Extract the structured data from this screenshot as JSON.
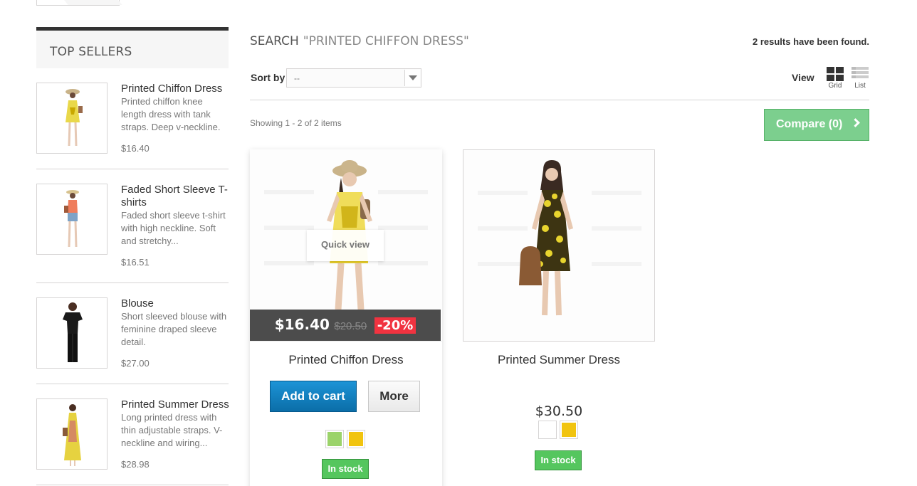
{
  "sidebar": {
    "title": "TOP SELLERS",
    "items": [
      {
        "name": "Printed Chiffon Dress",
        "desc": "Printed chiffon knee length dress with tank straps. Deep v-neckline.",
        "price": "$16.40"
      },
      {
        "name": "Faded Short Sleeve T-shirts",
        "desc": "Faded short sleeve t-shirt with high neckline. Soft and stretchy...",
        "price": "$16.51"
      },
      {
        "name": "Blouse",
        "desc": "Short sleeved blouse with feminine draped sleeve detail.",
        "price": "$27.00"
      },
      {
        "name": "Printed Summer Dress",
        "desc": "Long printed dress with thin adjustable straps. V-neckline and wiring...",
        "price": "$28.98"
      }
    ]
  },
  "search": {
    "label": "SEARCH",
    "query": "\"PRINTED CHIFFON DRESS\"",
    "results": "2 results have been found."
  },
  "toolbar": {
    "sort_label": "Sort by",
    "sort_value": "--",
    "view_label": "View",
    "grid_label": "Grid",
    "list_label": "List",
    "showing": "Showing 1 - 2 of 2 items",
    "compare": "Compare (0)"
  },
  "products": [
    {
      "name": "Printed Chiffon Dress",
      "quick_view": "Quick view",
      "price": "$16.40",
      "old_price": "$20.50",
      "discount": "-20%",
      "add_to_cart": "Add to cart",
      "more": "More",
      "colors": [
        "#9bd36a",
        "#f1c40f"
      ],
      "stock": "In stock"
    },
    {
      "name": "Printed Summer Dress",
      "price": "$30.50",
      "colors": [
        "#ffffff",
        "#f1c40f"
      ],
      "stock": "In stock"
    }
  ]
}
